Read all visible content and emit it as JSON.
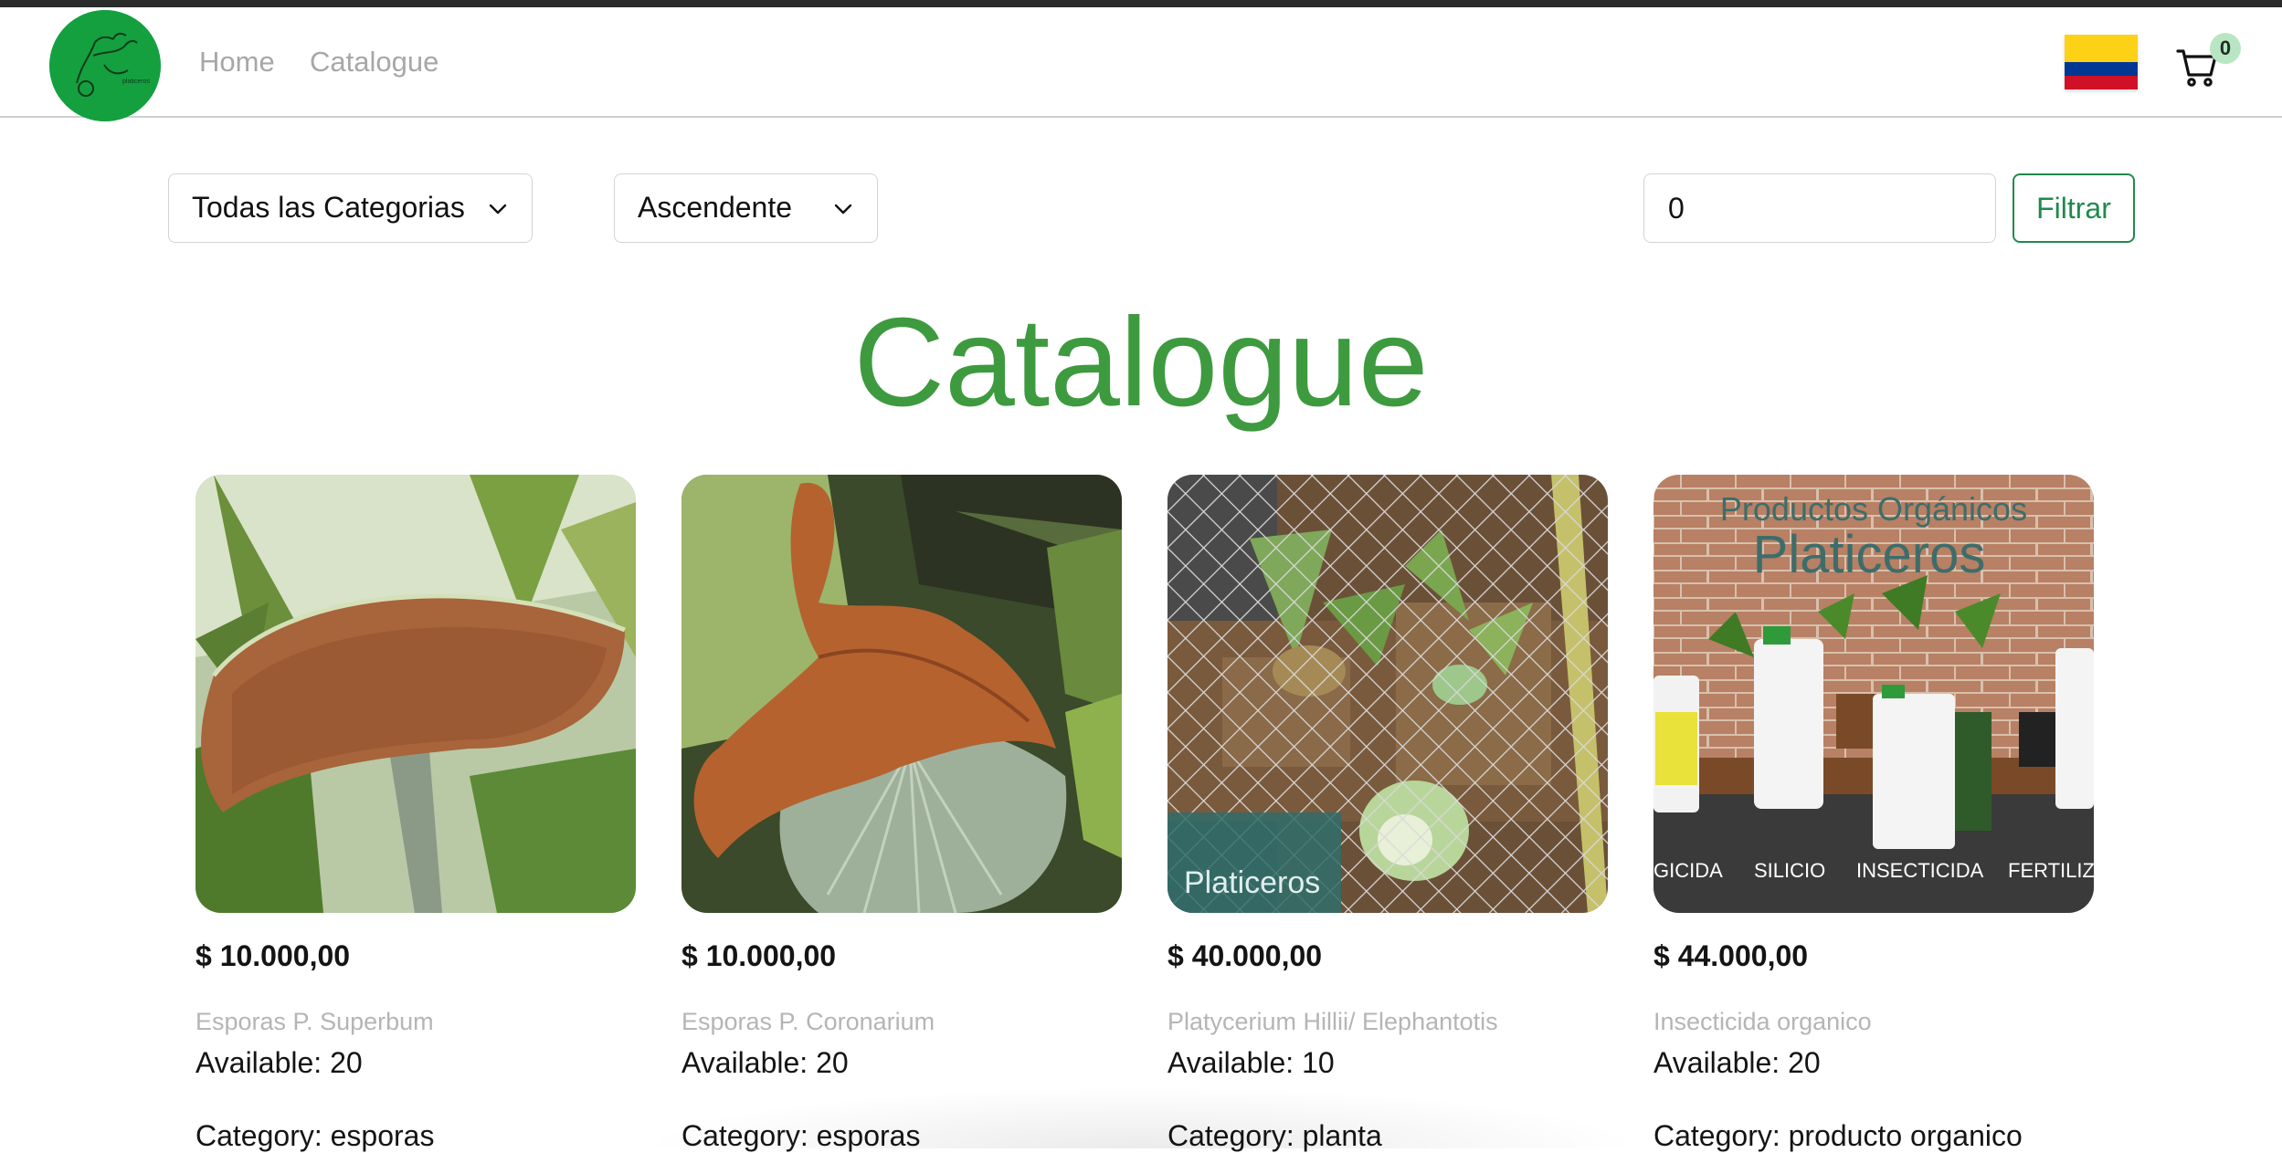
{
  "nav": {
    "home_label": "Home",
    "catalogue_label": "Catalogue",
    "flag": "colombia-flag",
    "cart_count": "0"
  },
  "filters": {
    "category_selected": "Todas las Categorias",
    "order_selected": "Ascendente",
    "price_value": "0",
    "filter_button_label": "Filtrar"
  },
  "page": {
    "title": "Catalogue"
  },
  "products": [
    {
      "price": "$ 10.000,00",
      "name": "Esporas P. Superbum",
      "available": "Available: 20",
      "category": "Category: esporas"
    },
    {
      "price": "$ 10.000,00",
      "name": "Esporas P. Coronarium",
      "available": "Available: 20",
      "category": "Category: esporas"
    },
    {
      "price": "$ 40.000,00",
      "name": "Platycerium Hillii/ Elephantotis",
      "available": "Available: 10",
      "category": "Category: planta",
      "image_overlay_text": "Platiceros"
    },
    {
      "price": "$ 44.000,00",
      "name": "Insecticida organico",
      "available": "Available: 20",
      "category": "Category: producto organico",
      "image_header": "Productos Orgánicos",
      "image_title": "Platiceros",
      "image_labels": [
        "GICIDA",
        "SILICIO",
        "INSECTICIDA",
        "FERTILIZ"
      ]
    }
  ],
  "colors": {
    "accent_green": "#3e9a3f",
    "button_green": "#1f8a4c",
    "logo_green": "#15a040",
    "muted_text": "#b5b5b5"
  }
}
